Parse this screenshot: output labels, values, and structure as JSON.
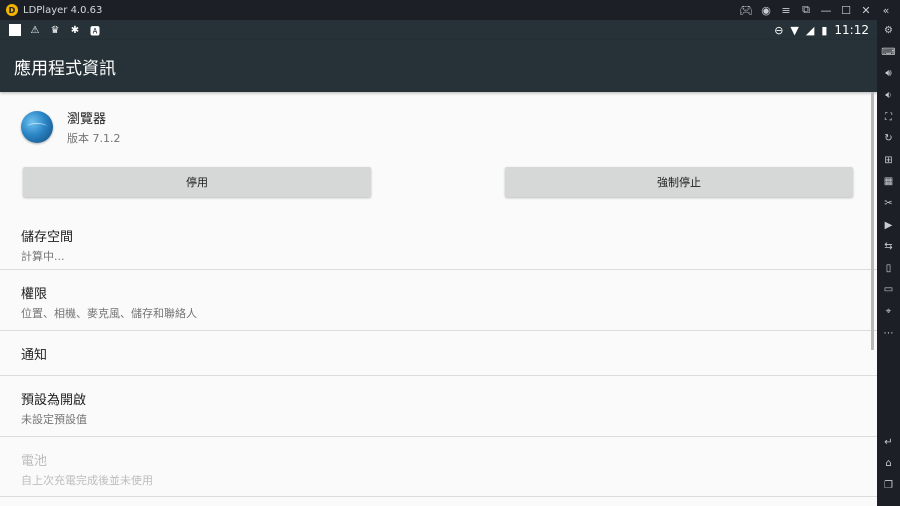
{
  "emulator": {
    "title": "LDPlayer 4.0.63",
    "controls": [
      "gamepad-icon",
      "user-icon",
      "menu-icon",
      "expand-icon",
      "minimize-icon",
      "maximize-icon",
      "close-icon",
      "collapse-icon"
    ]
  },
  "statusbar": {
    "left_icons": [
      "square-icon",
      "warning-icon",
      "crown-icon",
      "bug-icon",
      "a-box-icon"
    ],
    "right_icons": [
      "dnd-icon",
      "wifi-icon",
      "signal-icon",
      "battery-icon"
    ],
    "time": "11:12"
  },
  "appbar": {
    "title": "應用程式資訊"
  },
  "app": {
    "name": "瀏覽器",
    "version": "版本 7.1.2"
  },
  "buttons": {
    "disable": "停用",
    "force_stop": "強制停止"
  },
  "rows": [
    {
      "title": "儲存空間",
      "subtitle": "計算中..."
    },
    {
      "title": "權限",
      "subtitle": "位置、相機、麥克風、儲存和聯絡人"
    },
    {
      "title": "通知",
      "subtitle": ""
    },
    {
      "title": "預設為開啟",
      "subtitle": "未設定預設值"
    },
    {
      "title": "電池",
      "subtitle": "自上次充電完成後並未使用"
    }
  ],
  "sidebar": {
    "icons": [
      "settings-icon",
      "keyboard-icon",
      "volume-up-icon",
      "volume-down-icon",
      "screenshot-icon",
      "rotate-icon",
      "install-apk-icon",
      "macro-icon",
      "scissors-icon",
      "record-icon",
      "sync-icon",
      "shake-icon",
      "folder-icon",
      "location-icon",
      "more-icon"
    ],
    "nav_icons": [
      "back-icon",
      "home-icon",
      "recents-icon"
    ]
  }
}
